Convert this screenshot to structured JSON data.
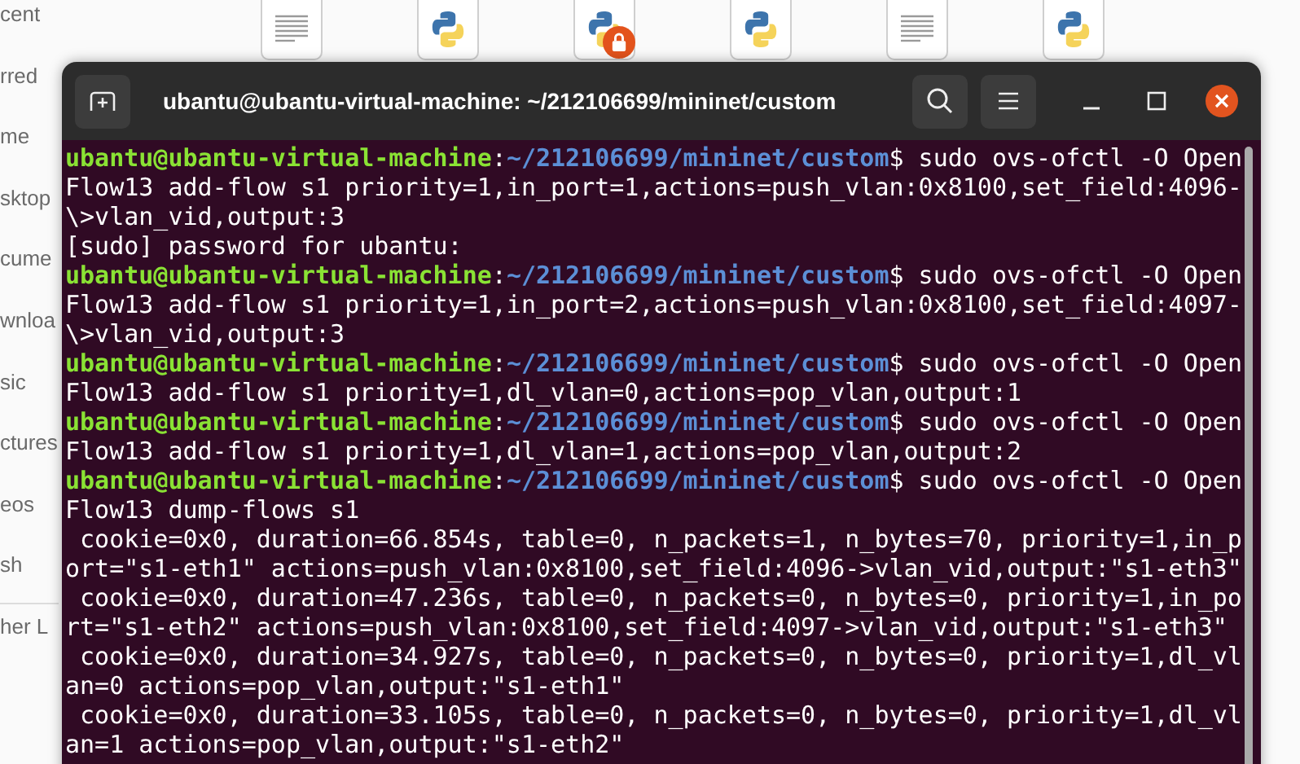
{
  "file_manager": {
    "sidebar_items": [
      {
        "label": "cent"
      },
      {
        "label": "rred"
      },
      {
        "label": "me"
      },
      {
        "label": "sktop"
      },
      {
        "label": "cume"
      },
      {
        "label": "wnloa"
      },
      {
        "label": "sic"
      },
      {
        "label": "ctures"
      },
      {
        "label": "eos"
      },
      {
        "label": "sh"
      },
      {
        "label": "her L",
        "divider_above": true
      }
    ],
    "files": [
      {
        "kind": "text",
        "locked": false
      },
      {
        "kind": "python",
        "locked": false
      },
      {
        "kind": "python",
        "locked": true
      },
      {
        "kind": "python",
        "locked": false
      },
      {
        "kind": "text",
        "locked": false
      },
      {
        "kind": "python",
        "locked": false
      }
    ]
  },
  "terminal": {
    "title": "ubantu@ubantu-virtual-machine: ~/212106699/mininet/custom",
    "lines": [
      {
        "kind": "prompt",
        "user": "ubantu@ubantu-virtual-machine",
        "sep": ":",
        "path": "~/212106699/mininet/custom",
        "command": "$ sudo ovs-ofctl -O Open"
      },
      {
        "kind": "output",
        "text": "Flow13 add-flow s1 priority=1,in_port=1,actions=push_vlan:0x8100,set_field:4096-"
      },
      {
        "kind": "output",
        "text": "\\>vlan_vid,output:3"
      },
      {
        "kind": "output",
        "text": "[sudo] password for ubantu:"
      },
      {
        "kind": "prompt",
        "user": "ubantu@ubantu-virtual-machine",
        "sep": ":",
        "path": "~/212106699/mininet/custom",
        "command": "$ sudo ovs-ofctl -O Open"
      },
      {
        "kind": "output",
        "text": "Flow13 add-flow s1 priority=1,in_port=2,actions=push_vlan:0x8100,set_field:4097-"
      },
      {
        "kind": "output",
        "text": "\\>vlan_vid,output:3"
      },
      {
        "kind": "prompt",
        "user": "ubantu@ubantu-virtual-machine",
        "sep": ":",
        "path": "~/212106699/mininet/custom",
        "command": "$ sudo ovs-ofctl -O Open"
      },
      {
        "kind": "output",
        "text": "Flow13 add-flow s1 priority=1,dl_vlan=0,actions=pop_vlan,output:1"
      },
      {
        "kind": "prompt",
        "user": "ubantu@ubantu-virtual-machine",
        "sep": ":",
        "path": "~/212106699/mininet/custom",
        "command": "$ sudo ovs-ofctl -O Open"
      },
      {
        "kind": "output",
        "text": "Flow13 add-flow s1 priority=1,dl_vlan=1,actions=pop_vlan,output:2"
      },
      {
        "kind": "prompt",
        "user": "ubantu@ubantu-virtual-machine",
        "sep": ":",
        "path": "~/212106699/mininet/custom",
        "command": "$ sudo ovs-ofctl -O Open"
      },
      {
        "kind": "output",
        "text": "Flow13 dump-flows s1"
      },
      {
        "kind": "output",
        "text": " cookie=0x0, duration=66.854s, table=0, n_packets=1, n_bytes=70, priority=1,in_p"
      },
      {
        "kind": "output",
        "text": "ort=\"s1-eth1\" actions=push_vlan:0x8100,set_field:4096->vlan_vid,output:\"s1-eth3\""
      },
      {
        "kind": "output",
        "text": " cookie=0x0, duration=47.236s, table=0, n_packets=0, n_bytes=0, priority=1,in_po"
      },
      {
        "kind": "output",
        "text": "rt=\"s1-eth2\" actions=push_vlan:0x8100,set_field:4097->vlan_vid,output:\"s1-eth3\""
      },
      {
        "kind": "output",
        "text": " cookie=0x0, duration=34.927s, table=0, n_packets=0, n_bytes=0, priority=1,dl_vl"
      },
      {
        "kind": "output",
        "text": "an=0 actions=pop_vlan,output:\"s1-eth1\""
      },
      {
        "kind": "output",
        "text": " cookie=0x0, duration=33.105s, table=0, n_packets=0, n_bytes=0, priority=1,dl_vl"
      },
      {
        "kind": "output",
        "text": "an=1 actions=pop_vlan,output:\"s1-eth2\""
      }
    ]
  }
}
